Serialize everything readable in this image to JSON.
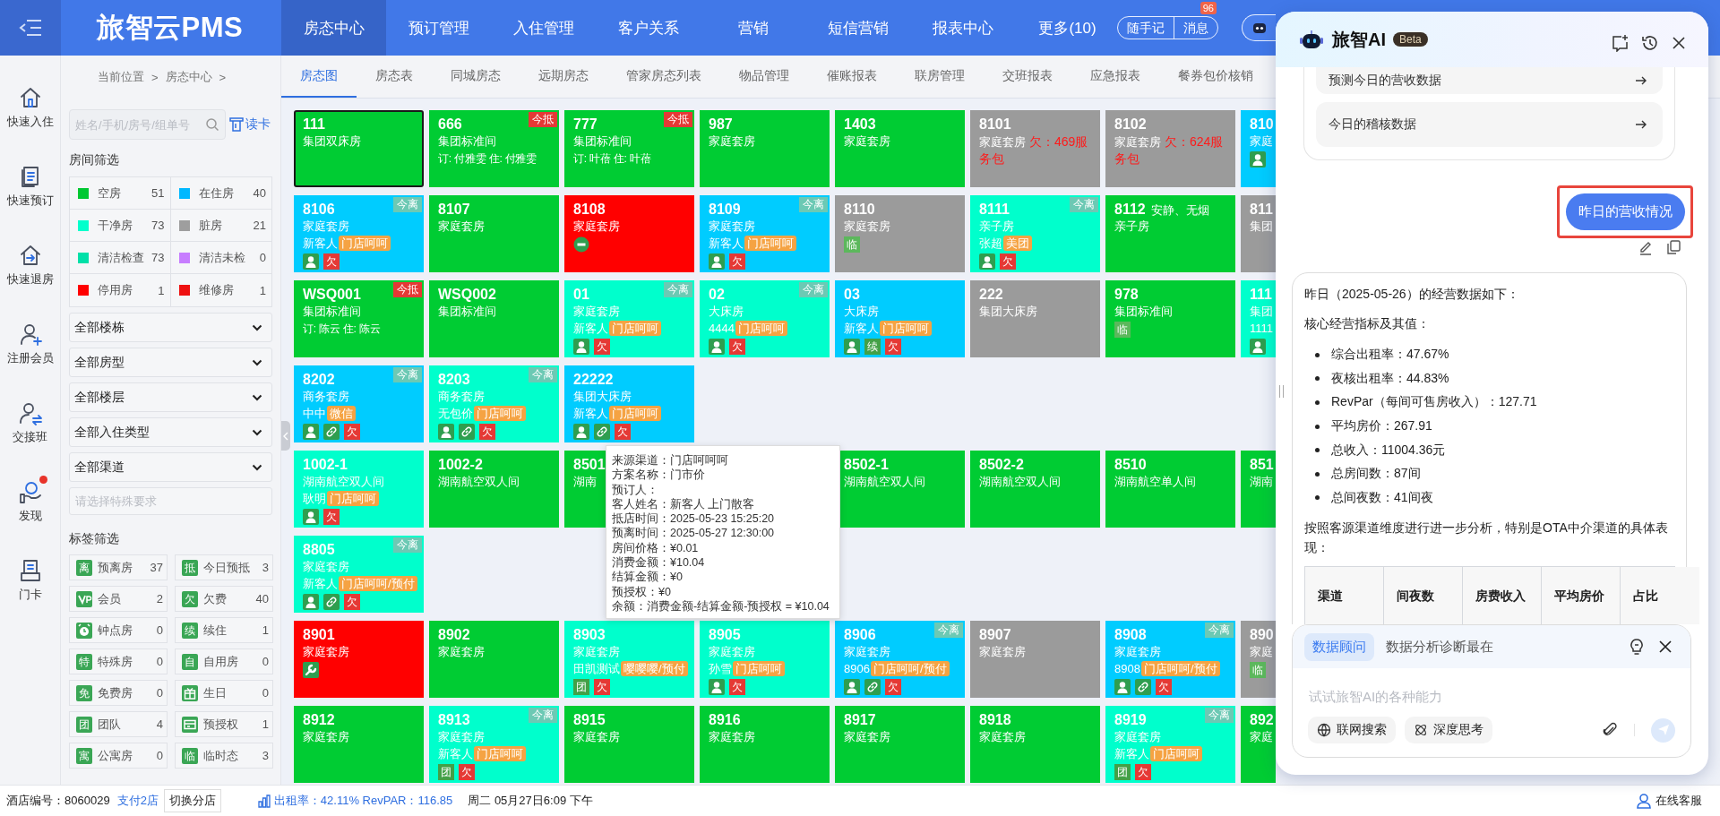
{
  "topbar": {
    "logo": "旅智云PMS",
    "nav": [
      {
        "label": "房态中心",
        "selected": true
      },
      {
        "label": "预订管理",
        "selected": false
      },
      {
        "label": "入住管理",
        "selected": false
      },
      {
        "label": "客户关系",
        "selected": false
      },
      {
        "label": "营销",
        "selected": false
      },
      {
        "label": "短信营销",
        "selected": false
      },
      {
        "label": "报表中心",
        "selected": false
      },
      {
        "label": "更多(10)",
        "selected": false
      }
    ],
    "quick_buttons": [
      "随手记",
      "消息"
    ],
    "message_count": "96"
  },
  "sidebar": {
    "items": [
      {
        "label": "快速入住",
        "kind": "checkin",
        "alert": false
      },
      {
        "label": "快速预订",
        "kind": "booking",
        "alert": false
      },
      {
        "label": "快速退房",
        "kind": "checkout",
        "alert": false
      },
      {
        "label": "注册会员",
        "kind": "member",
        "alert": false
      },
      {
        "label": "交接班",
        "kind": "handover",
        "alert": false
      },
      {
        "label": "发现",
        "kind": "discover",
        "alert": true
      },
      {
        "label": "门卡",
        "kind": "card",
        "alert": false
      }
    ]
  },
  "breadcrumb": [
    "当前位置",
    ">",
    "房态中心",
    ">"
  ],
  "tabs": [
    {
      "label": "房态图",
      "selected": true
    },
    {
      "label": "房态表",
      "selected": false
    },
    {
      "label": "同城房态",
      "selected": false
    },
    {
      "label": "远期房态",
      "selected": false
    },
    {
      "label": "管家房态列表",
      "selected": false
    },
    {
      "label": "物品管理",
      "selected": false
    },
    {
      "label": "催账报表",
      "selected": false
    },
    {
      "label": "联房管理",
      "selected": false
    },
    {
      "label": "交班报表",
      "selected": false
    },
    {
      "label": "应急报表",
      "selected": false
    },
    {
      "label": "餐券包价核销",
      "selected": false
    }
  ],
  "filters": {
    "search_placeholder": "姓名/手机/房号/组单号",
    "card_button": "读卡",
    "room_heading": "房间筛选",
    "room_filters": [
      {
        "label": "空房",
        "count": "51",
        "color": "#00c832"
      },
      {
        "label": "在住房",
        "count": "40",
        "color": "#00b8ff"
      },
      {
        "label": "干净房",
        "count": "73",
        "color": "#00ffcc"
      },
      {
        "label": "脏房",
        "count": "21",
        "color": "#9e9e9e"
      },
      {
        "label": "清洁检查",
        "count": "73",
        "color": "#00e0a8"
      },
      {
        "label": "清洁未检",
        "count": "0",
        "color": "#c77dff"
      },
      {
        "label": "停用房",
        "count": "1",
        "color": "#ff0000"
      },
      {
        "label": "维修房",
        "count": "1",
        "color": "#ee1111"
      }
    ],
    "selects": [
      "全部楼栋",
      "全部房型",
      "全部楼层",
      "全部入住类型",
      "全部渠道"
    ],
    "special_placeholder": "请选择特殊要求",
    "tag_heading": "标签筛选",
    "tags": [
      {
        "kind": "glyph",
        "glyph": "离",
        "label": "预离房",
        "count": "37"
      },
      {
        "kind": "glyph",
        "glyph": "抵",
        "label": "今日预抵",
        "count": "3"
      },
      {
        "kind": "vip",
        "label": "会员",
        "count": "2"
      },
      {
        "kind": "glyph",
        "glyph": "欠",
        "label": "欠费",
        "count": "40"
      },
      {
        "kind": "clock",
        "label": "钟点房",
        "count": "0"
      },
      {
        "kind": "glyph",
        "glyph": "续",
        "label": "续住",
        "count": "1"
      },
      {
        "kind": "glyph",
        "glyph": "特",
        "label": "特殊房",
        "count": "0"
      },
      {
        "kind": "glyph",
        "glyph": "自",
        "label": "自用房",
        "count": "0"
      },
      {
        "kind": "glyph",
        "glyph": "免",
        "label": "免费房",
        "count": "0"
      },
      {
        "kind": "gift",
        "label": "生日",
        "count": "0"
      },
      {
        "kind": "glyph",
        "glyph": "团",
        "label": "团队",
        "count": "4"
      },
      {
        "kind": "card",
        "label": "预授权",
        "count": "1"
      },
      {
        "kind": "glyph",
        "glyph": "寓",
        "label": "公寓房",
        "count": "0"
      },
      {
        "kind": "glyph",
        "glyph": "临",
        "label": "临时态",
        "count": "3"
      }
    ]
  },
  "rooms": {
    "rows": [
      [
        {
          "number": "111",
          "type": "集团双床房",
          "color": "#00cc33",
          "selected": true
        },
        {
          "number": "666",
          "type": "集团标准间",
          "booking": "订: 付雅雯 住: 付雅雯",
          "color": "#00cc33",
          "badge": {
            "kind": "arrive",
            "text": "今抵"
          },
          "selected": false
        },
        {
          "number": "777",
          "type": "集团标准间",
          "booking": "订: 叶蓓 住: 叶蓓",
          "color": "#00cc33",
          "badge": {
            "kind": "arrive",
            "text": "今抵"
          },
          "selected": false
        },
        {
          "number": "987",
          "type": "家庭套房",
          "color": "#00cc33",
          "selected": false
        },
        {
          "number": "1403",
          "type": "家庭套房",
          "color": "#00cc33",
          "selected": false
        },
        {
          "number": "8101",
          "type": "家庭套房",
          "debt": "欠：469服务包",
          "color": "#9b9b9b",
          "selected": false
        },
        {
          "number": "8102",
          "type": "家庭套房",
          "debt": "欠：624服务包",
          "color": "#9b9b9b",
          "selected": false
        },
        {
          "number": "810",
          "type": "家庭",
          "color": "#00ccff",
          "marks": [
            {
              "kind": "guest"
            }
          ],
          "selected": false
        }
      ],
      [
        {
          "number": "8106",
          "type": "家庭套房",
          "guest": "新客人",
          "channel": "门店呵呵",
          "color": "#00ccff",
          "badge": {
            "kind": "depart",
            "text": "今离"
          },
          "marks": [
            {
              "kind": "guest"
            },
            {
              "kind": "glyph",
              "text": "欠",
              "color": "#e53935"
            }
          ],
          "selected": false
        },
        {
          "number": "8107",
          "type": "家庭套房",
          "color": "#00cc33",
          "selected": false
        },
        {
          "number": "8108",
          "type": "家庭套房",
          "color": "#ff0000",
          "marks": [
            {
              "kind": "minus"
            }
          ],
          "selected": false
        },
        {
          "number": "8109",
          "type": "家庭套房",
          "guest": "新客人",
          "channel": "门店呵呵",
          "color": "#00ccff",
          "badge": {
            "kind": "depart",
            "text": "今离"
          },
          "marks": [
            {
              "kind": "guest"
            },
            {
              "kind": "glyph",
              "text": "欠",
              "color": "#e53935"
            }
          ],
          "selected": false
        },
        {
          "number": "8110",
          "type": "家庭套房",
          "color": "#9b9b9b",
          "marks": [
            {
              "kind": "glyph",
              "text": "临",
              "color": "#5cb85c"
            }
          ],
          "selected": false
        },
        {
          "number": "8111",
          "type": "亲子房",
          "guest": "张超",
          "channel": "美团",
          "color": "#00ffcc",
          "badge": {
            "kind": "depart",
            "text": "今离"
          },
          "marks": [
            {
              "kind": "guest"
            },
            {
              "kind": "glyph",
              "text": "欠",
              "color": "#e53935"
            }
          ],
          "selected": false
        },
        {
          "number": "8112",
          "note": "安静、无烟",
          "type": "亲子房",
          "color": "#00cc33",
          "selected": false
        },
        {
          "number": "811",
          "type": "集团",
          "color": "#9b9b9b",
          "selected": false
        }
      ],
      [
        {
          "number": "WSQ001",
          "type": "集团标准间",
          "booking": "订: 陈云 住: 陈云",
          "color": "#00cc33",
          "badge": {
            "kind": "arrive",
            "text": "今抵"
          },
          "selected": false
        },
        {
          "number": "WSQ002",
          "type": "集团标准间",
          "color": "#00cc33",
          "selected": false
        },
        {
          "number": "01",
          "type": "家庭套房",
          "guest": "新客人",
          "channel": "门店呵呵",
          "color": "#00ffcc",
          "badge": {
            "kind": "depart",
            "text": "今离"
          },
          "marks": [
            {
              "kind": "guest"
            },
            {
              "kind": "glyph",
              "text": "欠",
              "color": "#e53935"
            }
          ],
          "selected": false
        },
        {
          "number": "02",
          "type": "大床房",
          "guest": "4444",
          "channel": "门店呵呵",
          "color": "#00ffcc",
          "badge": {
            "kind": "depart",
            "text": "今离"
          },
          "marks": [
            {
              "kind": "guest"
            },
            {
              "kind": "glyph",
              "text": "欠",
              "color": "#e53935"
            }
          ],
          "selected": false
        },
        {
          "number": "03",
          "type": "大床房",
          "guest": "新客人",
          "channel": "门店呵呵",
          "color": "#00ccff",
          "marks": [
            {
              "kind": "guest"
            },
            {
              "kind": "glyph",
              "text": "续",
              "color": "#43a047"
            },
            {
              "kind": "glyph",
              "text": "欠",
              "color": "#e53935"
            }
          ],
          "selected": false
        },
        {
          "number": "222",
          "type": "集团大床房",
          "color": "#9b9b9b",
          "selected": false
        },
        {
          "number": "978",
          "type": "集团标准间",
          "color": "#00cc33",
          "marks": [
            {
              "kind": "glyph",
              "text": "临",
              "color": "#5cb85c"
            }
          ],
          "selected": false
        },
        {
          "number": "111",
          "type": "集团",
          "guest": "1111",
          "color": "#00ffcc",
          "marks": [
            {
              "kind": "guest"
            }
          ],
          "selected": false
        }
      ],
      [
        {
          "number": "8202",
          "type": "商务套房",
          "guest": "中中",
          "channel": "微信",
          "color": "#00ccff",
          "badge": {
            "kind": "depart",
            "text": "今离"
          },
          "marks": [
            {
              "kind": "guest"
            },
            {
              "kind": "link"
            },
            {
              "kind": "glyph",
              "text": "欠",
              "color": "#e53935"
            }
          ],
          "selected": false
        },
        {
          "number": "8203",
          "type": "商务套房",
          "guest": "无包价",
          "channel": "门店呵呵",
          "color": "#00ffcc",
          "badge": {
            "kind": "depart",
            "text": "今离"
          },
          "marks": [
            {
              "kind": "guest"
            },
            {
              "kind": "link"
            },
            {
              "kind": "glyph",
              "text": "欠",
              "color": "#e53935"
            }
          ],
          "selected": false
        },
        {
          "number": "22222",
          "type": "集团大床房",
          "guest": "新客人",
          "channel": "门店呵呵",
          "color": "#00ccff",
          "marks": [
            {
              "kind": "guest"
            },
            {
              "kind": "link"
            },
            {
              "kind": "glyph",
              "text": "欠",
              "color": "#e53935"
            }
          ],
          "selected": false
        }
      ],
      [
        {
          "number": "1002-1",
          "type": "湖南航空双人间",
          "guest": "耿明",
          "channel": "门店呵呵",
          "color": "#00ffcc",
          "marks": [
            {
              "kind": "guest"
            },
            {
              "kind": "glyph",
              "text": "欠",
              "color": "#e53935"
            }
          ],
          "selected": false
        },
        {
          "number": "1002-2",
          "type": "湖南航空双人间",
          "color": "#00cc33",
          "selected": false
        },
        {
          "number": "8501",
          "type": "湖南",
          "color": "#00cc33",
          "selected": false
        },
        null,
        {
          "number": "8502-1",
          "type": "湖南航空双人间",
          "color": "#00cc33",
          "selected": false
        },
        {
          "number": "8502-2",
          "type": "湖南航空双人间",
          "color": "#00cc33",
          "selected": false
        },
        {
          "number": "8510",
          "type": "湖南航空单人间",
          "color": "#00cc33",
          "selected": false
        },
        {
          "number": "851",
          "type": "湖南",
          "color": "#00cc33",
          "selected": false
        }
      ],
      [
        {
          "number": "8805",
          "type": "家庭套房",
          "guest": "新客人",
          "channel": "门店呵呵/预付",
          "color": "#00ffcc",
          "badge": {
            "kind": "depart",
            "text": "今离"
          },
          "marks": [
            {
              "kind": "guest"
            },
            {
              "kind": "link"
            },
            {
              "kind": "glyph",
              "text": "欠",
              "color": "#e53935"
            }
          ],
          "selected": false
        }
      ],
      [
        {
          "number": "8901",
          "type": "家庭套房",
          "color": "#ff0000",
          "marks": [
            {
              "kind": "wrench"
            }
          ],
          "selected": false
        },
        {
          "number": "8902",
          "type": "家庭套房",
          "color": "#00cc33",
          "selected": false
        },
        {
          "number": "8903",
          "type": "家庭套房",
          "guest": "田凯测试",
          "channel": "嘤嘤嘤/预付",
          "color": "#00ffcc",
          "marks": [
            {
              "kind": "glyph",
              "text": "团",
              "color": "#43a047"
            },
            {
              "kind": "glyph",
              "text": "欠",
              "color": "#e53935"
            }
          ],
          "selected": false
        },
        {
          "number": "8905",
          "type": "家庭套房",
          "guest": "孙雪",
          "channel": "门店呵呵",
          "color": "#00ffcc",
          "marks": [
            {
              "kind": "guest"
            },
            {
              "kind": "glyph",
              "text": "欠",
              "color": "#e53935"
            }
          ],
          "selected": false
        },
        {
          "number": "8906",
          "type": "家庭套房",
          "guest": "8906",
          "channel": "门店呵呵/预付",
          "color": "#00ccff",
          "badge": {
            "kind": "depart",
            "text": "今离"
          },
          "marks": [
            {
              "kind": "guest"
            },
            {
              "kind": "link"
            },
            {
              "kind": "glyph",
              "text": "欠",
              "color": "#e53935"
            }
          ],
          "selected": false
        },
        {
          "number": "8907",
          "type": "家庭套房",
          "color": "#9b9b9b",
          "selected": false
        },
        {
          "number": "8908",
          "type": "家庭套房",
          "guest": "8908",
          "channel": "门店呵呵/预付",
          "color": "#00ccff",
          "badge": {
            "kind": "depart",
            "text": "今离"
          },
          "marks": [
            {
              "kind": "guest"
            },
            {
              "kind": "link"
            },
            {
              "kind": "glyph",
              "text": "欠",
              "color": "#e53935"
            }
          ],
          "selected": false
        },
        {
          "number": "890",
          "type": "家庭",
          "color": "#9b9b9b",
          "marks": [
            {
              "kind": "glyph",
              "text": "临",
              "color": "#5cb85c"
            }
          ],
          "selected": false
        }
      ],
      [
        {
          "number": "8912",
          "type": "家庭套房",
          "color": "#00cc33",
          "selected": false
        },
        {
          "number": "8913",
          "type": "家庭套房",
          "guest": "新客人",
          "channel": "门店呵呵",
          "color": "#00ffcc",
          "badge": {
            "kind": "depart",
            "text": "今离"
          },
          "marks": [
            {
              "kind": "glyph",
              "text": "团",
              "color": "#43a047"
            },
            {
              "kind": "glyph",
              "text": "欠",
              "color": "#e53935"
            }
          ],
          "selected": false
        },
        {
          "number": "8915",
          "type": "家庭套房",
          "color": "#00cc33",
          "selected": false
        },
        {
          "number": "8916",
          "type": "家庭套房",
          "color": "#00cc33",
          "selected": false
        },
        {
          "number": "8917",
          "type": "家庭套房",
          "color": "#00cc33",
          "selected": false
        },
        {
          "number": "8918",
          "type": "家庭套房",
          "color": "#00cc33",
          "selected": false
        },
        {
          "number": "8919",
          "type": "家庭套房",
          "guest": "新客人",
          "channel": "门店呵呵",
          "color": "#00ffcc",
          "badge": {
            "kind": "depart",
            "text": "今离"
          },
          "marks": [
            {
              "kind": "glyph",
              "text": "团",
              "color": "#43a047"
            },
            {
              "kind": "glyph",
              "text": "欠",
              "color": "#e53935"
            }
          ],
          "selected": false
        },
        {
          "number": "892",
          "type": "家庭",
          "color": "#00cc33",
          "selected": false
        }
      ]
    ]
  },
  "tooltip": {
    "lines": [
      "来源渠道：门店呵呵呵",
      "方案名称：门市价",
      "预订人：",
      "客人姓名：新客人 上门散客",
      "抵店时间：2025-05-23 15:25:20",
      "预离时间：2025-05-27 12:30:00",
      "房间价格：¥0.01",
      "消费金额：¥10.04",
      "结算金额：¥0",
      "预授权：¥0",
      "余额：消费金额-结算金额-预授权 = ¥10.04"
    ]
  },
  "status_bar": {
    "hotel": "酒店编号：8060029",
    "branch_link": "支付2店",
    "switch_button": "切换分店",
    "occupancy": "出租率：42.11% RevPAR：116.85",
    "datetime": "周二 05月27日6:09 下午",
    "support": "在线客服"
  },
  "ai": {
    "title": "旅智AI",
    "badge": "Beta",
    "suggestions": [
      "预测今日的营收数据",
      "今日的稽核数据"
    ],
    "user_message": {
      "text": "昨日的营收情况",
      "highlighted": true
    },
    "answer": {
      "intro": "昨日（2025-05-26）的经营数据如下：",
      "subheading": "核心经营指标及其值：",
      "bullets": [
        "综合出租率：47.67%",
        "夜核出租率：44.83%",
        "RevPar（每间可售房收入）：127.71",
        "平均房价：267.91",
        "总收入：11004.36元",
        "总房间数：87间",
        "总间夜数：41间夜"
      ],
      "paragraph": "按照客源渠道维度进行进一步分析，特别是OTA中介渠道的具体表现：",
      "table_columns": [
        "渠道",
        "间夜数",
        "房费收入",
        "平均房价",
        "占比"
      ]
    },
    "composer": {
      "mode": {
        "label": "数据顾问",
        "selected": true
      },
      "mode_text": "数据分析诊断最在",
      "placeholder": "试试旅智AI的各种能力",
      "tools": [
        {
          "kind": "web",
          "label": "联网搜索"
        },
        {
          "kind": "think",
          "label": "深度思考"
        }
      ],
      "send_disabled": true
    }
  }
}
